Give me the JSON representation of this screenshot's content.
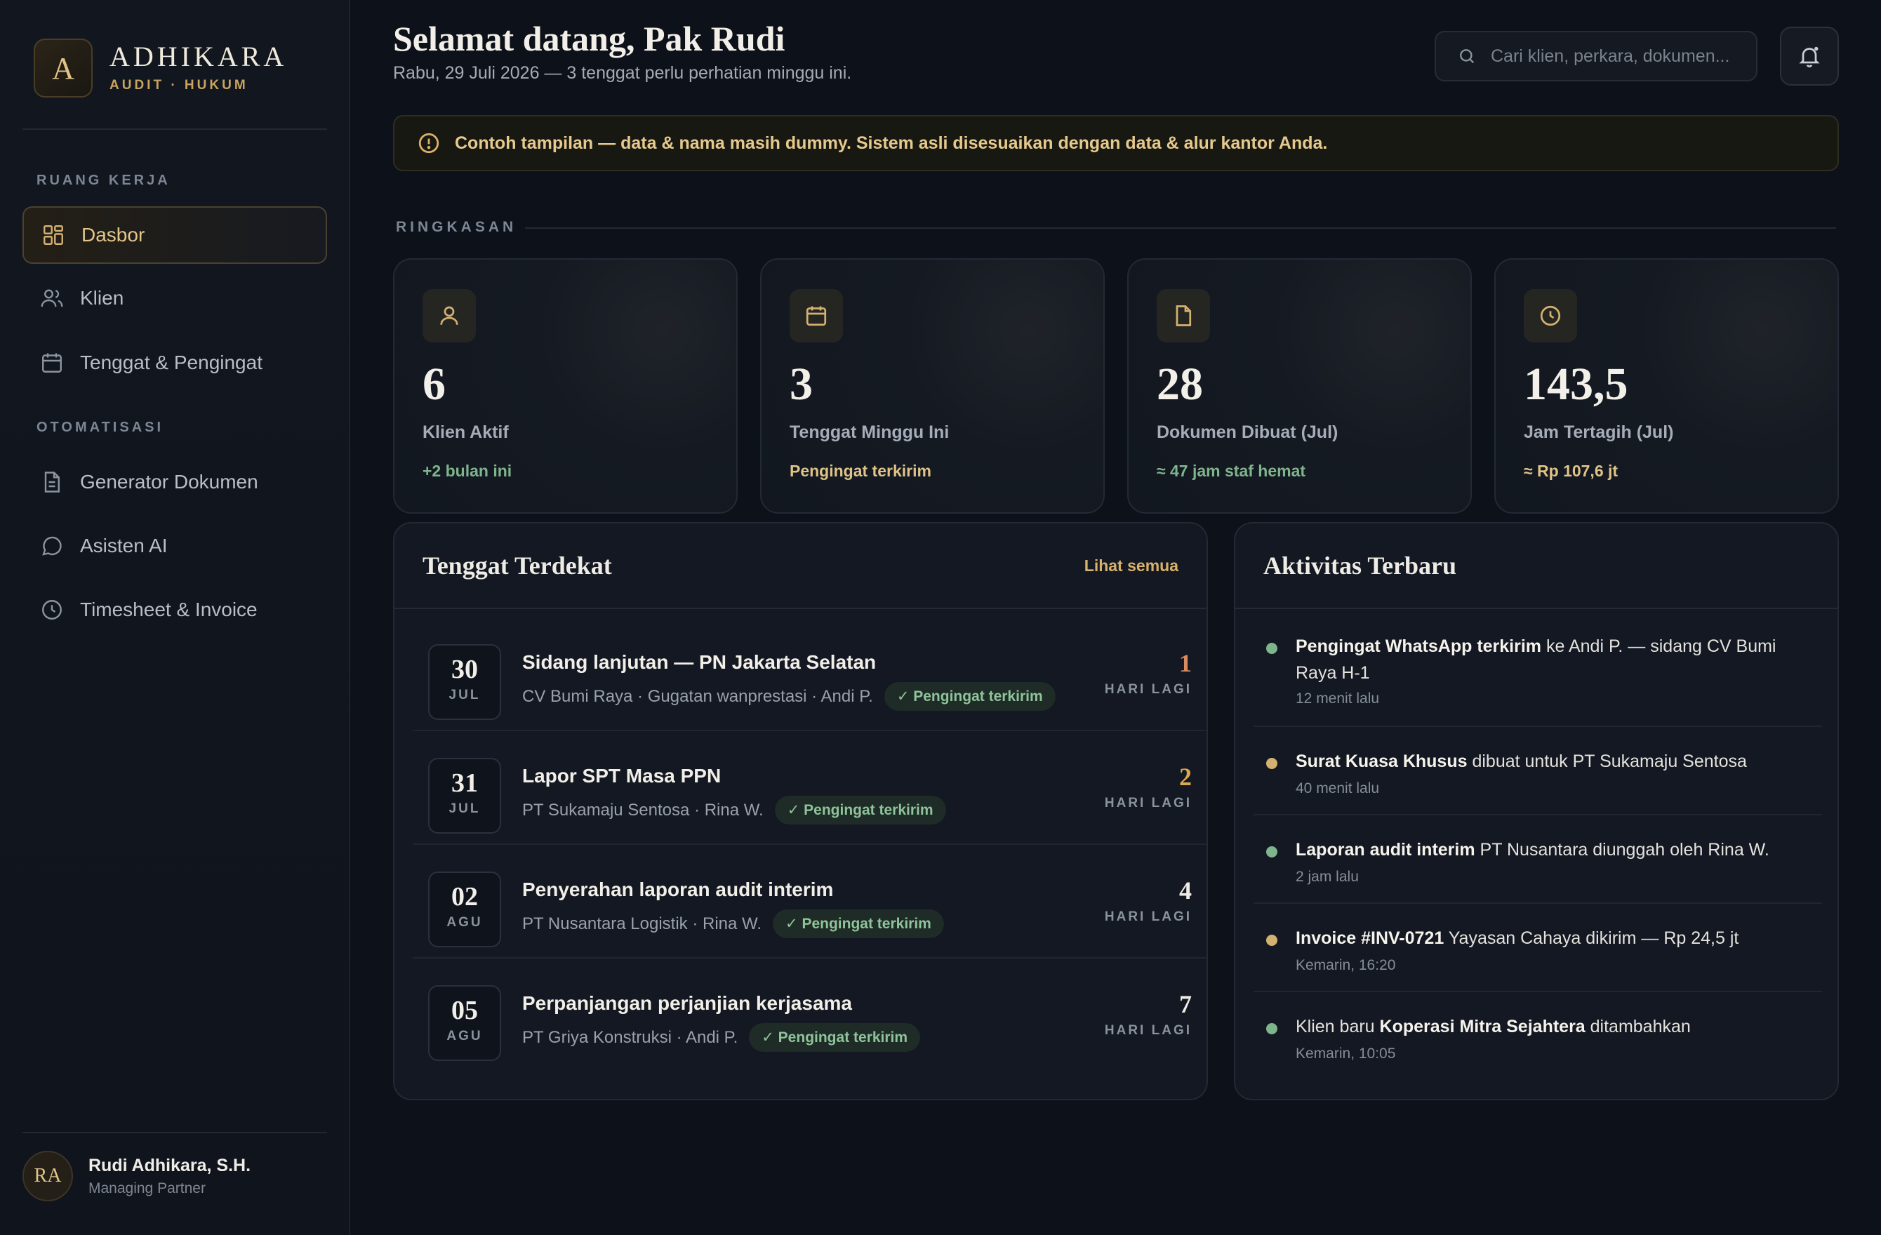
{
  "brand": {
    "logo_letter": "A",
    "name": "ADHIKARA",
    "sub": "AUDIT · HUKUM",
    "accent": "#d3b171"
  },
  "sidebar": {
    "section_workspace": "RUANG KERJA",
    "section_automation": "OTOMATISASI",
    "items": [
      {
        "label": "Dasbor",
        "icon": "dashboard-icon",
        "active": true
      },
      {
        "label": "Klien",
        "icon": "users-icon"
      },
      {
        "label": "Tenggat & Pengingat",
        "icon": "calendar-icon"
      },
      {
        "label": "Generator Dokumen",
        "icon": "document-icon"
      },
      {
        "label": "Asisten AI",
        "icon": "chat-icon"
      },
      {
        "label": "Timesheet & Invoice",
        "icon": "clock-icon"
      }
    ]
  },
  "user": {
    "initials": "RA",
    "name": "Rudi Adhikara, S.H.",
    "role": "Managing Partner"
  },
  "header": {
    "greeting": "Selamat datang, Pak Rudi",
    "subtitle": "Rabu, 29 Juli 2026 — 3 tenggat perlu perhatian minggu ini.",
    "search_placeholder": "Cari klien, perkara, dokumen..."
  },
  "notice": "Contoh tampilan — data & nama masih dummy. Sistem asli disesuaikan dengan data & alur kantor Anda.",
  "summary": {
    "title": "RINGKASAN",
    "cards": [
      {
        "value": "6",
        "label": "Klien Aktif",
        "note": "+2 bulan ini",
        "icon": "user-icon"
      },
      {
        "value": "3",
        "label": "Tenggat Minggu Ini",
        "note": "Pengingat terkirim",
        "icon": "calendar-icon"
      },
      {
        "value": "28",
        "label": "Dokumen Dibuat (Jul)",
        "note": "≈ 47 jam staf hemat",
        "icon": "file-icon"
      },
      {
        "value": "143,5",
        "label": "Jam Tertagih (Jul)",
        "note": "≈ Rp 107,6 jt",
        "icon": "clock-icon"
      }
    ]
  },
  "deadlines": {
    "title": "Tenggat Terdekat",
    "link": "Lihat semua",
    "items": [
      {
        "day": "30",
        "month": "JUL",
        "title": "Sidang lanjutan — PN Jakarta Selatan",
        "meta": "CV Bumi Raya · Gugatan wanprestasi · Andi P.",
        "badge": "✓ Pengingat terkirim",
        "count": "1",
        "unit": "HARI LAGI",
        "color": "#d98a5f"
      },
      {
        "day": "31",
        "month": "JUL",
        "title": "Lapor SPT Masa PPN",
        "meta": "PT Sukamaju Sentosa · Rina W.",
        "badge": "✓ Pengingat terkirim",
        "count": "2",
        "unit": "HARI LAGI",
        "color": "#d8a94e"
      },
      {
        "day": "02",
        "month": "AGU",
        "title": "Penyerahan laporan audit interim",
        "meta": "PT Nusantara Logistik · Rina W.",
        "badge": "✓ Pengingat terkirim",
        "count": "4",
        "unit": "HARI LAGI",
        "color": "#efece5"
      },
      {
        "day": "05",
        "month": "AGU",
        "title": "Perpanjangan perjanjian kerjasama",
        "meta": "PT Griya Konstruksi · Andi P.",
        "badge": "✓ Pengingat terkirim",
        "count": "7",
        "unit": "HARI LAGI",
        "color": "#efece5"
      }
    ]
  },
  "activity": {
    "title": "Aktivitas Terbaru",
    "items": [
      {
        "bold": "Pengingat WhatsApp terkirim",
        "pre": "",
        "post": " ke Andi P. — sidang CV Bumi Raya H-1",
        "time": "12 menit lalu",
        "dot": "#7fb58c"
      },
      {
        "bold": "Surat Kuasa Khusus",
        "pre": "",
        "post": " dibuat untuk PT Sukamaju Sentosa",
        "time": "40 menit lalu",
        "dot": "#d3b171"
      },
      {
        "bold": "Laporan audit interim",
        "pre": "",
        "post": " PT Nusantara diunggah oleh Rina W.",
        "time": "2 jam lalu",
        "dot": "#7fb58c"
      },
      {
        "bold": "Invoice #INV-0721",
        "pre": "",
        "post": " Yayasan Cahaya dikirim — Rp 24,5 jt",
        "time": "Kemarin, 16:20",
        "dot": "#d3b171"
      },
      {
        "bold": "Koperasi Mitra Sejahtera",
        "pre": "Klien baru ",
        "post": " ditambahkan",
        "time": "Kemarin, 10:05",
        "dot": "#7fb58c"
      }
    ]
  }
}
